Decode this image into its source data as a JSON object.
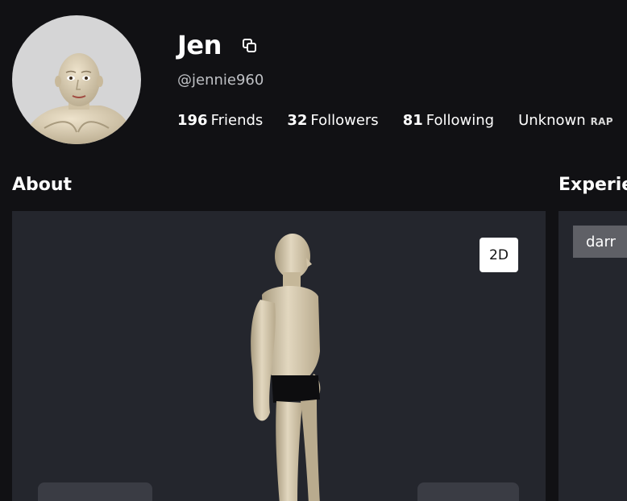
{
  "profile": {
    "display_name": "Jen",
    "username": "@jennie960",
    "avatar_label": "avatar",
    "copy_icon": "copy-icon"
  },
  "stats": {
    "friends_count": "196",
    "friends_label": "Friends",
    "followers_count": "32",
    "followers_label": "Followers",
    "following_count": "81",
    "following_label": "Following",
    "rap_value": "Unknown",
    "rap_label": "RAP"
  },
  "sections": {
    "about_title": "About",
    "experiences_title": "Experie"
  },
  "viewer": {
    "mode_button": "2D"
  },
  "experiences": {
    "tag": "darr"
  },
  "colors": {
    "background": "#111114",
    "panel": "#24262d",
    "avatar_bg": "#d5d5d6",
    "skin": "#d9ccb1",
    "muted_text": "#bfc1c5"
  }
}
